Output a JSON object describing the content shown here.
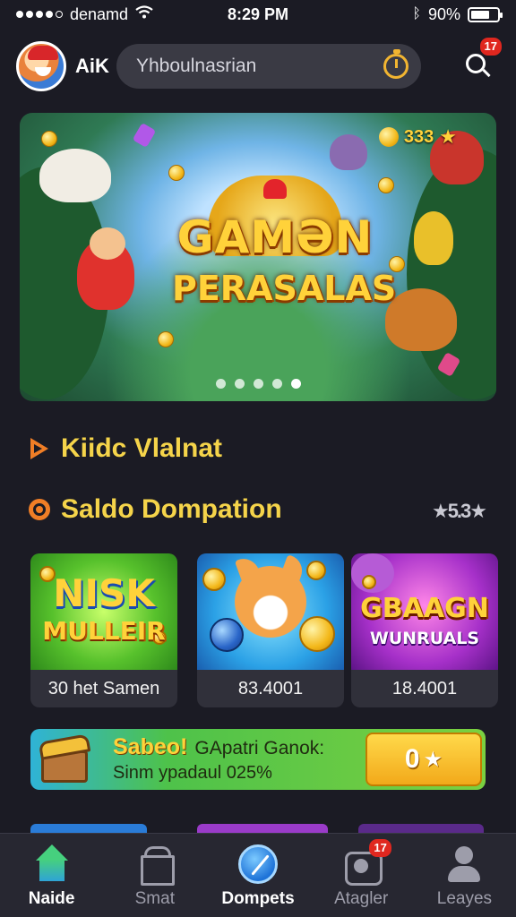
{
  "status_bar": {
    "carrier": "denamd",
    "time": "8:29 PM",
    "battery": "90%"
  },
  "header": {
    "username": "AiK",
    "search_placeholder": "Yhboulnasrian",
    "notification_count": "17"
  },
  "hero": {
    "title_line1": "GAMƏN",
    "title_line2": "PERASALAS",
    "coin_value": "333",
    "slides_total": 5,
    "active_slide": 4
  },
  "sections": {
    "first_title": "Kiidc Vlalnat",
    "second_title": "Saldo Dompation",
    "rating": "★5.3★"
  },
  "games": [
    {
      "art_line1": "NISK",
      "art_line2": "MULLEIR",
      "label": "30 het Samen"
    },
    {
      "art_line1": "",
      "art_line2": "",
      "label": "83.4001"
    },
    {
      "art_line1": "GBAAGN",
      "art_line2": "WUNRUALS",
      "label": "18.4001"
    }
  ],
  "promo": {
    "headline": "Sabeo!",
    "headline_rest": "GApatri Ganok:",
    "subline": "Sinm ypadaul 025%",
    "button_value": "0"
  },
  "bottom_nav": [
    {
      "label": "Naide",
      "icon": "home-icon"
    },
    {
      "label": "Smat",
      "icon": "store-icon"
    },
    {
      "label": "Dompets",
      "icon": "compass-icon"
    },
    {
      "label": "Atagler",
      "icon": "bag-icon",
      "badge": "17"
    },
    {
      "label": "Leayes",
      "icon": "user-icon"
    }
  ],
  "colors": {
    "background": "#1b1b24",
    "accent_yellow": "#f5d44a",
    "accent_orange": "#f07e26",
    "badge_red": "#e0271f"
  }
}
